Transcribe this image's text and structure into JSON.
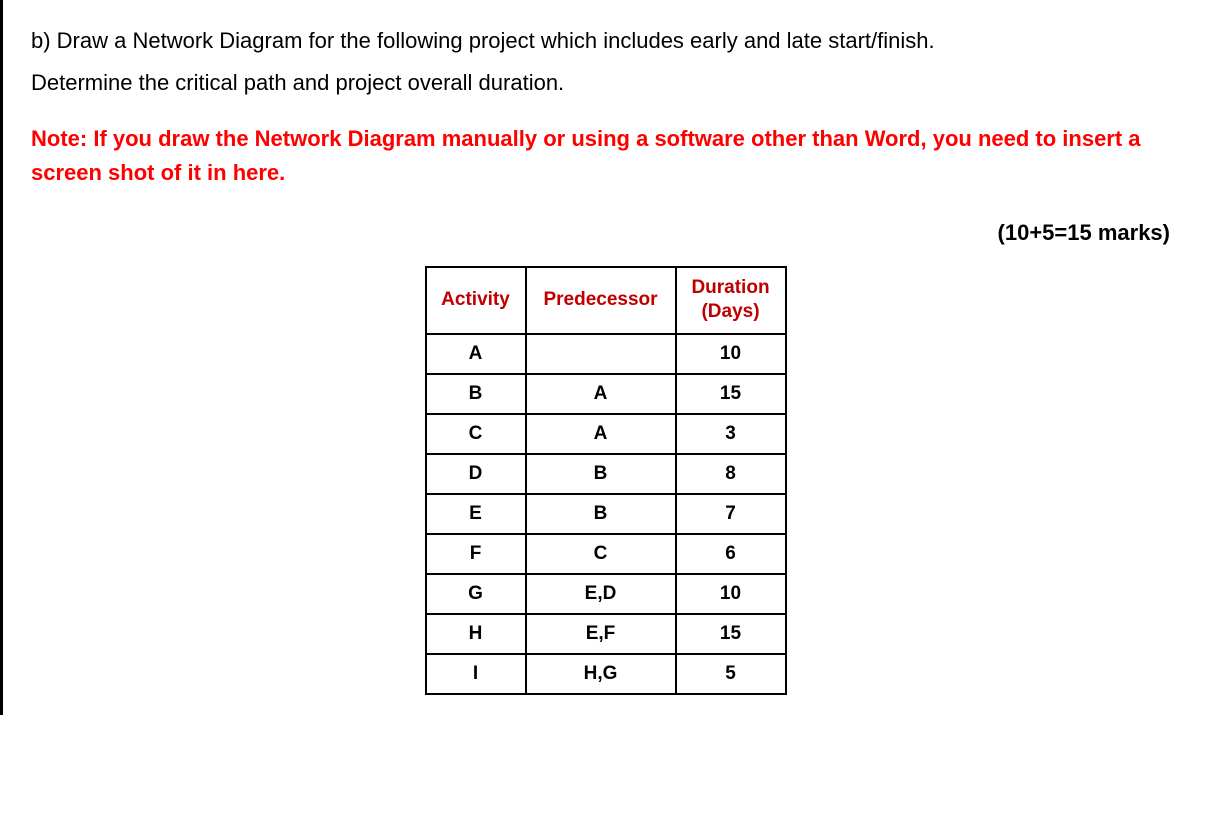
{
  "instruction": {
    "line1": "b) Draw a Network Diagram for the following project which includes early and late start/finish.",
    "line2": "Determine the critical path and project overall duration."
  },
  "note": "Note: If you draw the Network Diagram manually or using a software other than Word, you need to insert a screen shot of it in here.",
  "marks": "(10+5=15 marks)",
  "table": {
    "headers": {
      "activity": "Activity",
      "predecessor": "Predecessor",
      "duration_line1": "Duration",
      "duration_line2": "(Days)"
    },
    "rows": [
      {
        "activity": "A",
        "predecessor": "",
        "duration": "10"
      },
      {
        "activity": "B",
        "predecessor": "A",
        "duration": "15"
      },
      {
        "activity": "C",
        "predecessor": "A",
        "duration": "3"
      },
      {
        "activity": "D",
        "predecessor": "B",
        "duration": "8"
      },
      {
        "activity": "E",
        "predecessor": "B",
        "duration": "7"
      },
      {
        "activity": "F",
        "predecessor": "C",
        "duration": "6"
      },
      {
        "activity": "G",
        "predecessor": "E,D",
        "duration": "10"
      },
      {
        "activity": "H",
        "predecessor": "E,F",
        "duration": "15"
      },
      {
        "activity": "I",
        "predecessor": "H,G",
        "duration": "5"
      }
    ]
  }
}
